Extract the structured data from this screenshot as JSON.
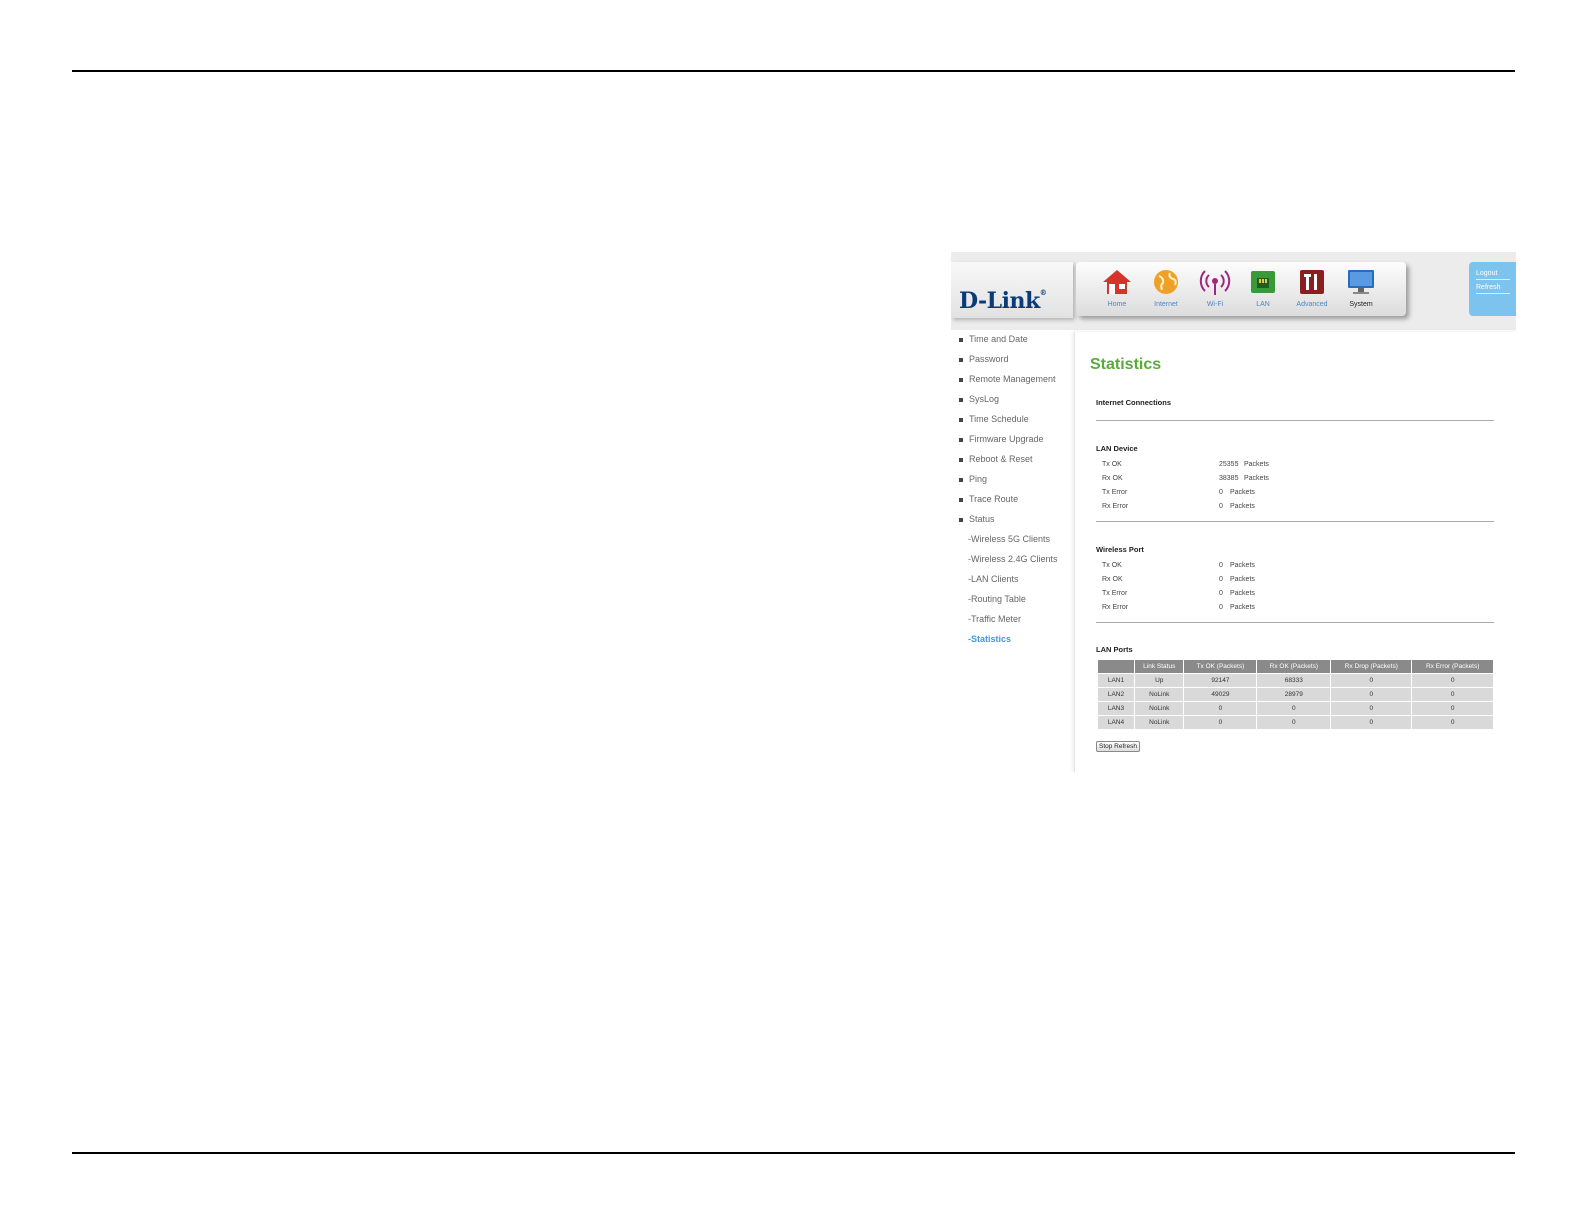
{
  "brand": {
    "logo": "D-Link",
    "reg": "®"
  },
  "nav": [
    {
      "label": "Home",
      "icon": "home-icon"
    },
    {
      "label": "Internet",
      "icon": "globe-icon"
    },
    {
      "label": "Wi-Fi",
      "icon": "wifi-icon"
    },
    {
      "label": "LAN",
      "icon": "lan-icon"
    },
    {
      "label": "Advanced",
      "icon": "tools-icon"
    },
    {
      "label": "System",
      "icon": "monitor-icon"
    }
  ],
  "top_links": {
    "logout": "Logout",
    "refresh": "Refresh"
  },
  "sidebar": {
    "items": [
      "Time and Date",
      "Password",
      "Remote Management",
      "SysLog",
      "Time Schedule",
      "Firmware Upgrade",
      "Reboot & Reset",
      "Ping",
      "Trace Route",
      "Status"
    ],
    "sub_items": [
      "-Wireless 5G Clients",
      "-Wireless 2.4G Clients",
      "-LAN Clients",
      "-Routing Table",
      "-Traffic Meter",
      "-Statistics"
    ]
  },
  "page": {
    "title": "Statistics",
    "internet_section": "Internet Connections",
    "lan_device": {
      "heading": "LAN Device",
      "rows": [
        {
          "label": "Tx OK",
          "value": "25355",
          "unit": "Packets"
        },
        {
          "label": "Rx OK",
          "value": "38385",
          "unit": "Packets"
        },
        {
          "label": "Tx Error",
          "value": "0",
          "unit": "Packets"
        },
        {
          "label": "Rx Error",
          "value": "0",
          "unit": "Packets"
        }
      ]
    },
    "wireless_port": {
      "heading": "Wireless Port",
      "rows": [
        {
          "label": "Tx OK",
          "value": "0",
          "unit": "Packets"
        },
        {
          "label": "Rx OK",
          "value": "0",
          "unit": "Packets"
        },
        {
          "label": "Tx Error",
          "value": "0",
          "unit": "Packets"
        },
        {
          "label": "Rx Error",
          "value": "0",
          "unit": "Packets"
        }
      ]
    },
    "lan_ports": {
      "heading": "LAN Ports",
      "columns": [
        "",
        "Link Status",
        "Tx OK (Packets)",
        "Rx OK (Packets)",
        "Rx Drop (Packets)",
        "Rx Error (Packets)"
      ],
      "rows": [
        [
          "LAN1",
          "Up",
          "92147",
          "68333",
          "0",
          "0"
        ],
        [
          "LAN2",
          "NoLink",
          "49029",
          "28979",
          "0",
          "0"
        ],
        [
          "LAN3",
          "NoLink",
          "0",
          "0",
          "0",
          "0"
        ],
        [
          "LAN4",
          "NoLink",
          "0",
          "0",
          "0",
          "0"
        ]
      ]
    },
    "stop_refresh": "Stop Refresh"
  },
  "colors": {
    "title_green": "#5aaa3c",
    "active_link": "#3b9be0",
    "nav_label": "#4a86c8",
    "side_panel": "#7cc4ee"
  }
}
